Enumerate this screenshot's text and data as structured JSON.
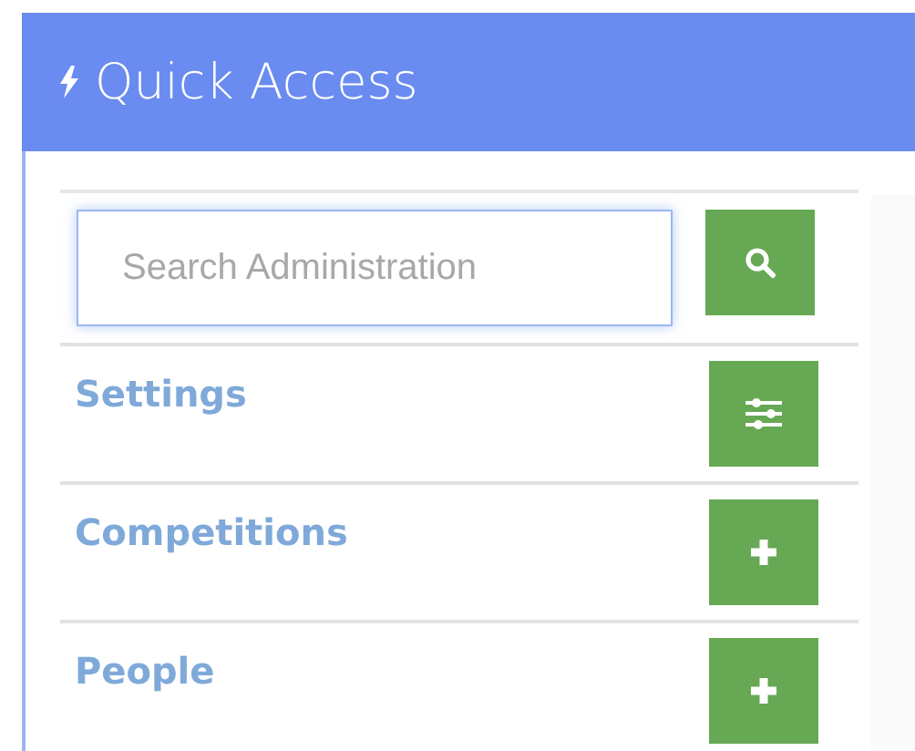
{
  "panel": {
    "title": "Quick Access"
  },
  "search": {
    "placeholder": "Search Administration"
  },
  "items": [
    {
      "label": "Settings",
      "kind": "settings"
    },
    {
      "label": "Competitions",
      "kind": "add"
    },
    {
      "label": "People",
      "kind": "add"
    }
  ]
}
